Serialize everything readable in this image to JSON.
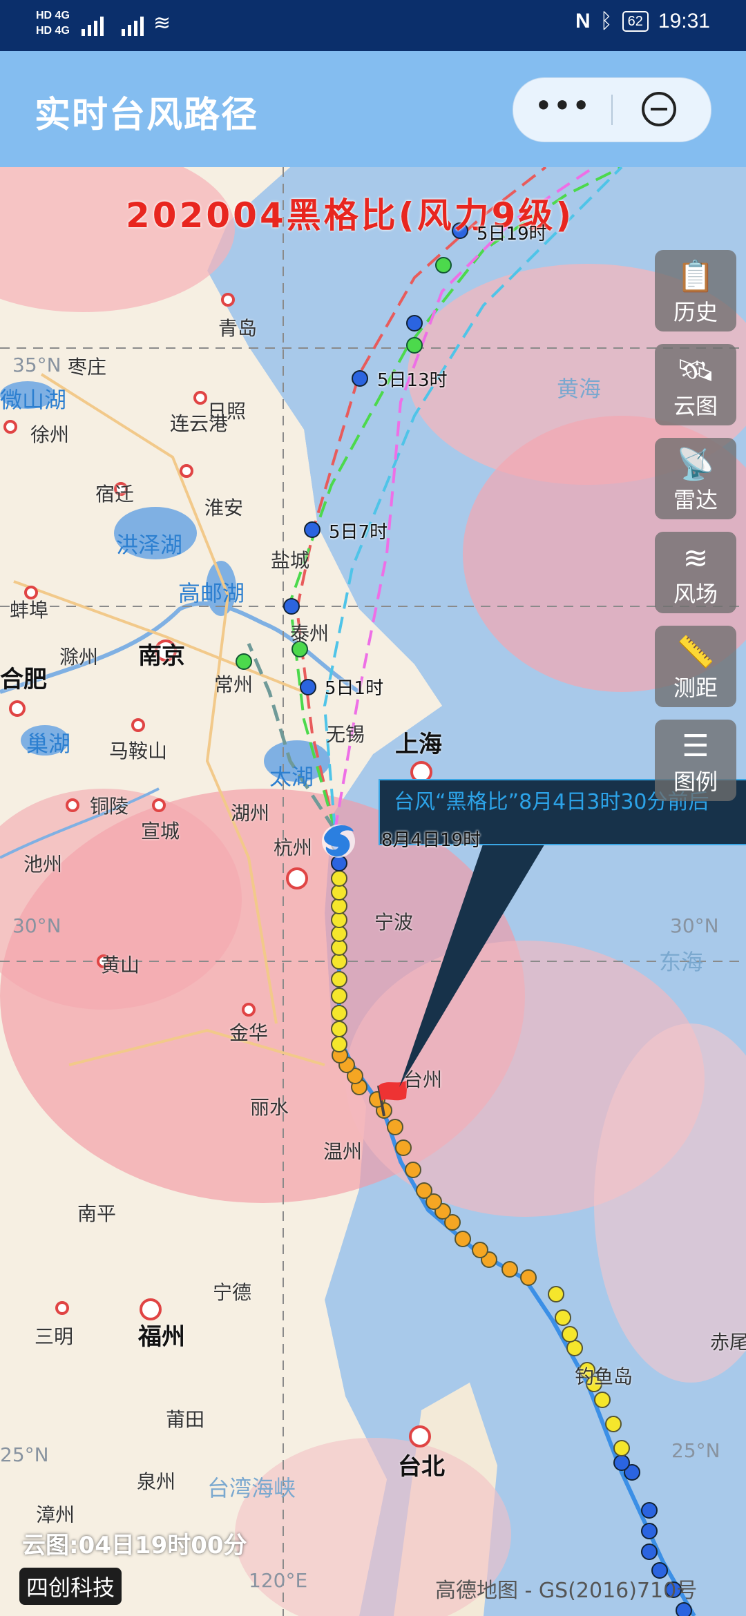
{
  "status_bar": {
    "net1": "HD 4G",
    "net2": "HD 4G",
    "battery": "62",
    "time": "19:31"
  },
  "header": {
    "title": "实时台风路径",
    "more_label": "•••"
  },
  "map": {
    "storm_title": "202004黑格比(风力9级)",
    "side_buttons": [
      {
        "label": "历史",
        "icon": "clipboard-icon"
      },
      {
        "label": "云图",
        "icon": "satellite-icon"
      },
      {
        "label": "雷达",
        "icon": "radar-dish-icon"
      },
      {
        "label": "风场",
        "icon": "wind-icon"
      },
      {
        "label": "测距",
        "icon": "ruler-icon"
      },
      {
        "label": "图例",
        "icon": "list-icon"
      }
    ],
    "popup": {
      "line1": "台风“黑格比”8月4日3时30分前后",
      "line2": "8月4日19时"
    },
    "forecast_labels": [
      "5日19时",
      "5日13时",
      "5日7时",
      "5日1时"
    ],
    "places": [
      "青岛",
      "日照",
      "枣庄",
      "徐州",
      "连云港",
      "宿迁",
      "淮安",
      "蚌埠",
      "滁州",
      "南京",
      "合肥",
      "盐城",
      "泰州",
      "常州",
      "无锡",
      "上海",
      "马鞍山",
      "铜陵",
      "宣城",
      "湖州",
      "杭州",
      "池州",
      "黄山",
      "宁波",
      "金华",
      "丽水",
      "台州",
      "温州",
      "南平",
      "宁德",
      "三明",
      "福州",
      "莆田",
      "泉州",
      "漳州",
      "台北"
    ],
    "lakes": [
      "洪泽湖",
      "高邮湖",
      "巢湖",
      "太湖",
      "微山湖"
    ],
    "seas": [
      "黄海",
      "东海",
      "钓鱼岛",
      "台湾海峡",
      "赤尾"
    ],
    "coords": [
      "35°N",
      "30°N",
      "30°N",
      "25°N",
      "25°N",
      "120°E"
    ],
    "cloud_time": "云图:04日19时00分",
    "brand": "四创科技",
    "copyright": "高德地图 - GS(2016)710号"
  }
}
